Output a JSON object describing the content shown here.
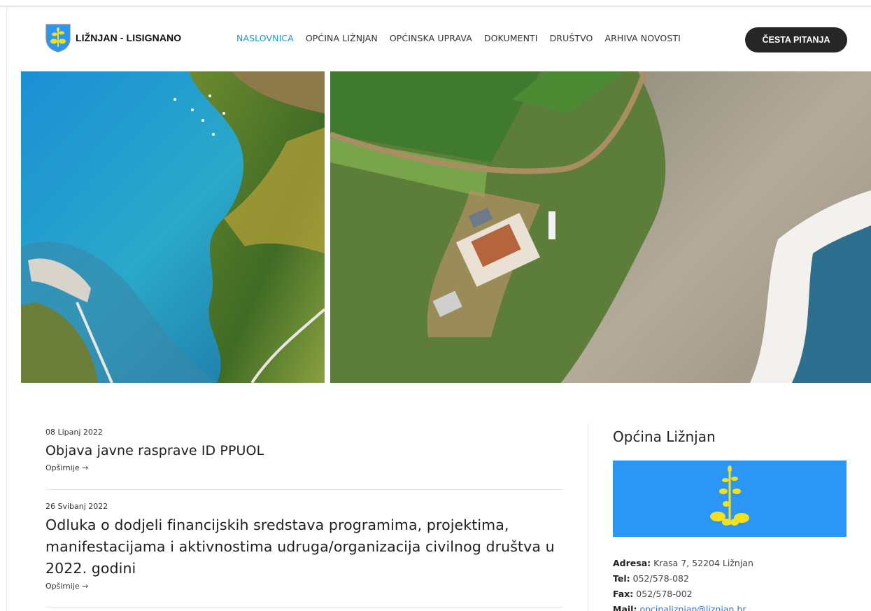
{
  "header": {
    "brand": "LIŽNJAN - LISIGNANO",
    "nav": [
      "NASLOVNICA",
      "OPĆINA LIŽNJAN",
      "OPĆINSKA UPRAVA",
      "DOKUMENTI",
      "DRUŠTVO",
      "ARHIVA NOVOSTI"
    ],
    "active_index": 0,
    "cta": "ČESTA PITANJA"
  },
  "news": [
    {
      "date": "08 Lipanj 2022",
      "title": "Objava javne rasprave ID PPUOL",
      "more": "Opširnije →"
    },
    {
      "date": "26 Svibanj 2022",
      "title": "Odluka o dodjeli financijskih sredstava programima, projektima, manifestacijama i aktivnostima udruga/organizacija civilnog društva u 2022. godini",
      "more": "Opširnije →"
    }
  ],
  "sidebar": {
    "title": "Općina Ližnjan",
    "contact": {
      "address_label": "Adresa:",
      "address": "Krasa 7, 52204 Ližnjan",
      "tel_label": "Tel:",
      "tel": "052/578-082",
      "fax_label": "Fax:",
      "fax": "052/578-002",
      "mail_label": "Mail:",
      "mail": "opcinaliznjan@liznjan.hr"
    }
  },
  "colors": {
    "accent": "#2196c9",
    "cta_bg": "#262626",
    "flag_blue": "#2c96f6",
    "flag_yellow": "#f5e11a"
  }
}
